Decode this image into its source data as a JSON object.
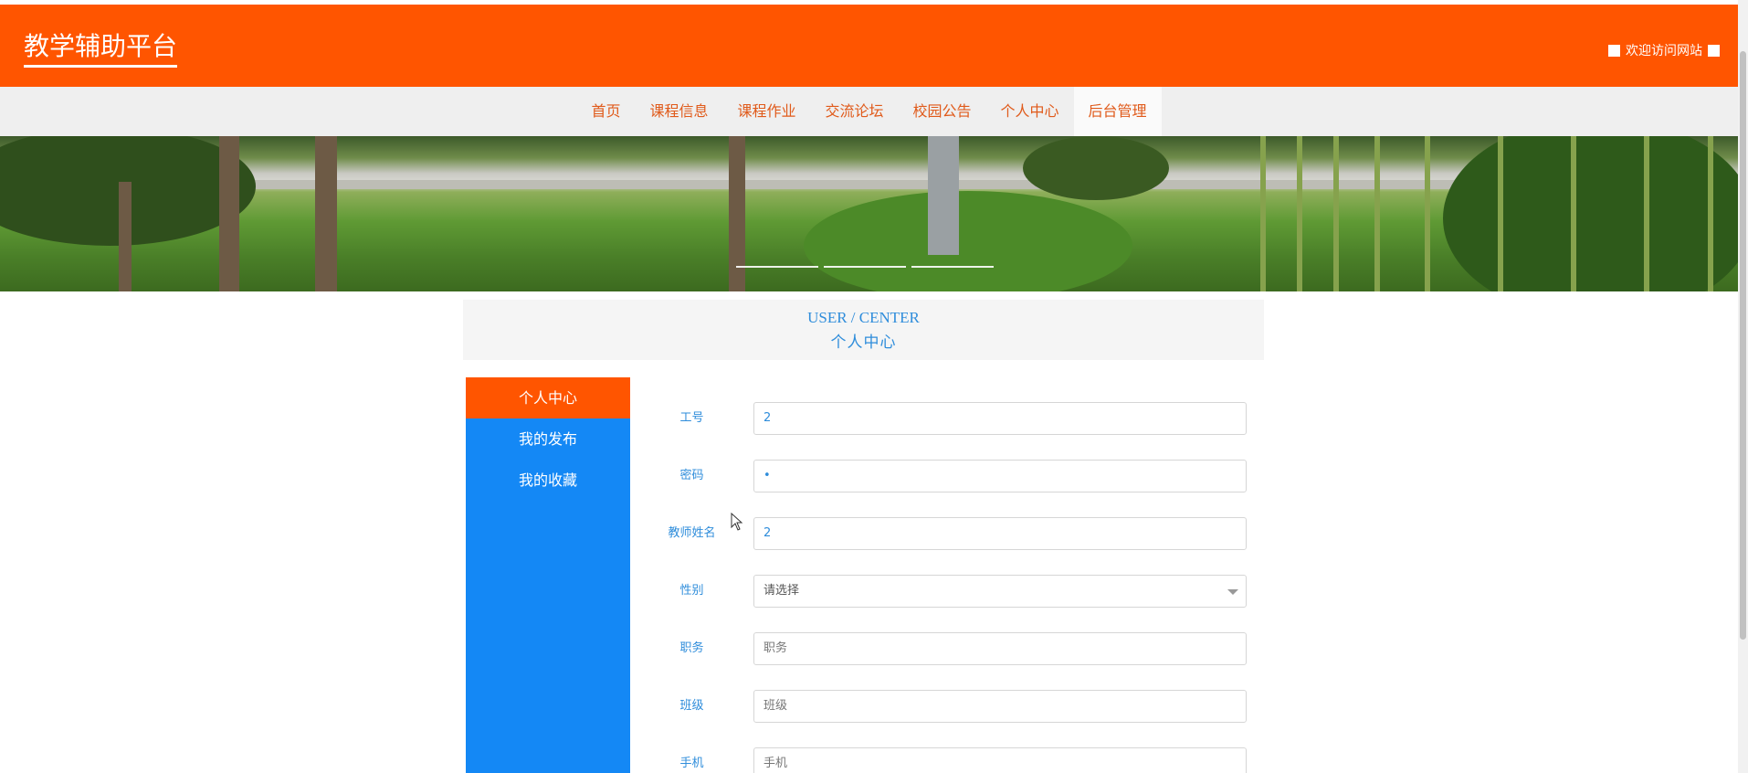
{
  "header": {
    "logo": "教学辅助平台",
    "welcome": "欢迎访问网站"
  },
  "nav": {
    "items": [
      "首页",
      "课程信息",
      "课程作业",
      "交流论坛",
      "校园公告",
      "个人中心",
      "后台管理"
    ],
    "active_index": 6
  },
  "banner": {
    "slide_count": 3
  },
  "user_center": {
    "title_en": "USER / CENTER",
    "title_cn": "个人中心"
  },
  "sidebar": {
    "items": [
      "个人中心",
      "我的发布",
      "我的收藏"
    ],
    "active_index": 0
  },
  "form": {
    "fields": [
      {
        "label": "工号",
        "value": "2",
        "placeholder": ""
      },
      {
        "label": "密码",
        "value": "•",
        "placeholder": ""
      },
      {
        "label": "教师姓名",
        "value": "2",
        "placeholder": ""
      },
      {
        "label": "性别",
        "value": "请选择",
        "placeholder": ""
      },
      {
        "label": "职务",
        "value": "",
        "placeholder": "职务"
      },
      {
        "label": "班级",
        "value": "",
        "placeholder": "班级"
      },
      {
        "label": "手机",
        "value": "",
        "placeholder": "手机"
      }
    ]
  },
  "colors": {
    "brand_orange": "#ff5500",
    "sidebar_blue": "#1488f5",
    "text_blue": "#2f8ddb",
    "nav_text": "#e05a1a"
  }
}
